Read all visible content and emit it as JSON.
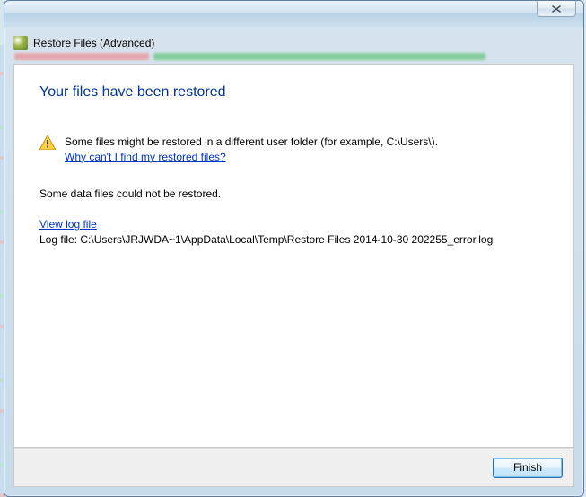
{
  "window": {
    "title": "Restore Files (Advanced)"
  },
  "heading": "Your files have been restored",
  "warning": {
    "message": "Some files might be restored in a different user folder (for example, C:\\Users\\).",
    "link_label": "Why can't I find my restored files?"
  },
  "error_para": "Some data files could not be restored.",
  "log": {
    "link_label": "View log file",
    "path_label": "Log file: C:\\Users\\JRJWDA~1\\AppData\\Local\\Temp\\Restore Files 2014-10-30 202255_error.log"
  },
  "buttons": {
    "finish": "Finish"
  }
}
